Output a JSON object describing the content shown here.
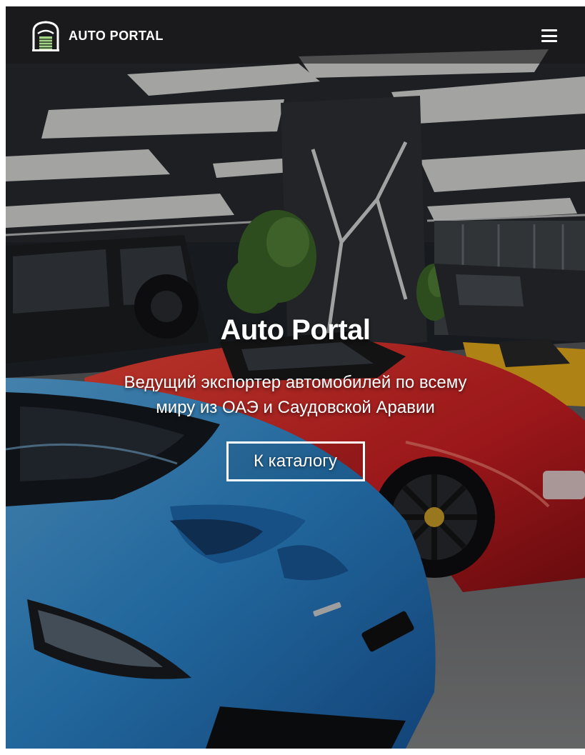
{
  "header": {
    "brand_name": "AUTO PORTAL",
    "brand_icon": "garage-icon",
    "menu_icon": "hamburger-menu-icon"
  },
  "hero": {
    "title": "Auto Portal",
    "subtitle": "Ведущий экспортер автомобилей по всему миру из ОАЭ и Саудовской Аравии",
    "cta_label": "К каталогу"
  },
  "colors": {
    "header_bg": "#1a1a1a",
    "text": "#ffffff",
    "car_blue": "#2f8fd9",
    "car_red": "#d62024",
    "car_yellow": "#f2b51d"
  }
}
